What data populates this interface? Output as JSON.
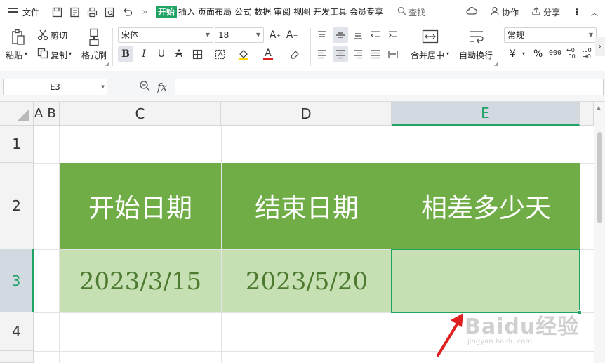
{
  "menubar": {
    "file": "文件",
    "tabs": [
      "开始",
      "插入",
      "页面布局",
      "公式",
      "数据",
      "审阅",
      "视图",
      "开发工具",
      "会员专享"
    ],
    "active_tab": "开始",
    "search": "查找",
    "collab": "协作",
    "share": "分享"
  },
  "ribbon": {
    "paste": "粘贴",
    "cut": "剪切",
    "copy": "复制",
    "format_painter": "格式刷",
    "font_name": "宋体",
    "font_size": "18",
    "merge_center": "合并居中",
    "wrap_text": "自动换行",
    "number_format": "常规",
    "currency_symbol": "¥",
    "percent_symbol": "%"
  },
  "formula_bar": {
    "name_box": "E3",
    "fx_label": "fx",
    "content": ""
  },
  "sheet": {
    "columns": [
      "A",
      "B",
      "C",
      "D",
      "E"
    ],
    "selected_column": "E",
    "rows": [
      "1",
      "2",
      "3",
      "4"
    ],
    "selected_row": "3",
    "header_row": [
      "开始日期",
      "结束日期",
      "相差多少天"
    ],
    "data_row": [
      "2023/3/15",
      "2023/5/20",
      ""
    ]
  },
  "watermark": {
    "brand": "Baidu经验",
    "url": "jingyan.baidu.com"
  },
  "colors": {
    "accent": "#21a366",
    "header_fill": "#70ad47",
    "data_fill": "#c6e0b4",
    "arrow": "#e02020"
  }
}
